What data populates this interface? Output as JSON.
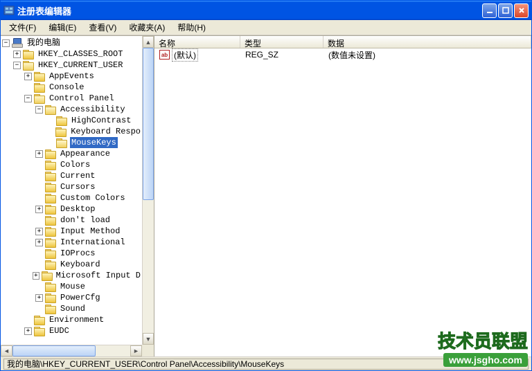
{
  "window": {
    "title": "注册表编辑器"
  },
  "menu": {
    "file": "文件(F)",
    "edit": "编辑(E)",
    "view": "查看(V)",
    "favorites": "收藏夹(A)",
    "help": "帮助(H)"
  },
  "tree": {
    "root": "我的电脑",
    "hkcr": "HKEY_CLASSES_ROOT",
    "hkcu": "HKEY_CURRENT_USER",
    "appEvents": "AppEvents",
    "console": "Console",
    "controlPanel": "Control Panel",
    "accessibility": "Accessibility",
    "highContrast": "HighContrast",
    "keyboardResponse": "Keyboard Respo",
    "mouseKeys": "MouseKeys",
    "appearance": "Appearance",
    "colors": "Colors",
    "current": "Current",
    "cursors": "Cursors",
    "customColors": "Custom Colors",
    "desktop": "Desktop",
    "dontLoad": "don't load",
    "inputMethod": "Input Method",
    "international": "International",
    "ioprocs": "IOProcs",
    "keyboard": "Keyboard",
    "msInput": "Microsoft Input D",
    "mouse": "Mouse",
    "powerCfg": "PowerCfg",
    "sound": "Sound",
    "environment": "Environment",
    "eudc": "EUDC"
  },
  "listHeader": {
    "name": "名称",
    "type": "类型",
    "data": "数据"
  },
  "listRows": [
    {
      "name": "(默认)",
      "type": "REG_SZ",
      "data": "(数值未设置)"
    }
  ],
  "statusbar": {
    "path": "我的电脑\\HKEY_CURRENT_USER\\Control Panel\\Accessibility\\MouseKeys"
  },
  "watermark": {
    "text1": "技术员联盟",
    "text2": "www.jsgho.com"
  }
}
